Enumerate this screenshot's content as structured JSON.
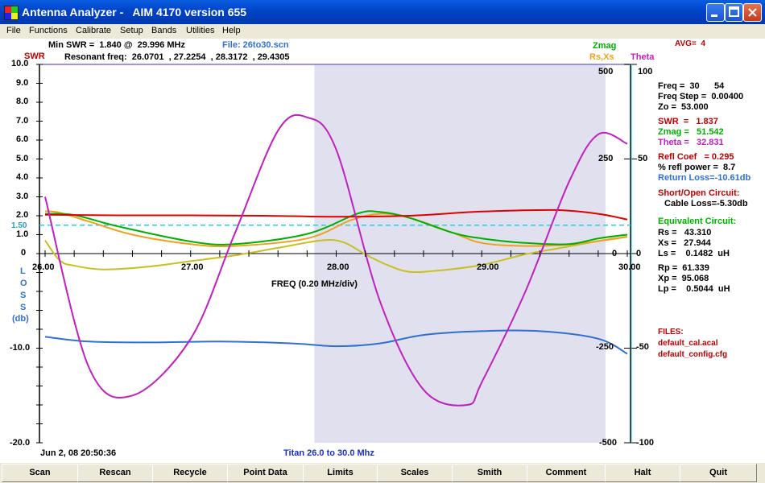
{
  "window": {
    "title": "Antenna Analyzer -   AIM 4170 version 655"
  },
  "menu": [
    "File",
    "Functions",
    "Calibrate",
    "Setup",
    "Bands",
    "Utilities",
    "Help"
  ],
  "header": {
    "min_swr": "Min SWR =  1.840 @  29.996 MHz",
    "file": "File: 26to30.scn",
    "resonant": "Resonant freq:  26.0701  , 27.2254  , 28.3172  , 29.4305",
    "avg": "AVG=  4",
    "swr_label": "SWR",
    "zmag_label": "Zmag",
    "rsxs_label": "Rs,Xs",
    "theta_label": "Theta"
  },
  "axes": {
    "swr_ticks": [
      "10.0",
      "9.0",
      "8.0",
      "7.0",
      "6.0",
      "5.0",
      "4.0",
      "3.0",
      "2.0",
      "1.0",
      "0"
    ],
    "swr_marker": "1.50",
    "loss_ticks": [
      "-10.0",
      "-20.0"
    ],
    "loss_label": [
      "L",
      "O",
      "S",
      "S",
      "(db)"
    ],
    "rs_ticks": [
      "500",
      "250",
      "0",
      "-250",
      "-500"
    ],
    "theta_ticks": [
      "100",
      "50",
      "0",
      "-50",
      "-100"
    ],
    "freq_ticks": [
      "26.00",
      "27.00",
      "28.00",
      "29.00",
      "30.00"
    ],
    "freq_label": "FREQ (0.20 MHz/div)"
  },
  "panel": {
    "freq": "Freq =  30      54",
    "freq_step": "Freq Step =  0.00400",
    "zo": "Zo =  53.000",
    "swr": "SWR  =   1.837",
    "zmag": "Zmag =   51.542",
    "theta": "Theta =   32.831",
    "refl_coef": "Refl Coef   = 0.295",
    "refl_power": "% refl power =  8.7",
    "return_loss": "Return Loss=-10.61db",
    "short_open": "Short/Open Circuit:",
    "cable_loss": "Cable Loss=-5.30db",
    "equiv": "Equivalent Circuit:",
    "rs": "Rs =   43.310",
    "xs": "Xs =   27.944",
    "ls": "Ls =    0.1482  uH",
    "rp": "Rp =  61.339",
    "xp": "Xp =  95.068",
    "lp": "Lp =    0.5044  uH",
    "files_label": "FILES:",
    "cal_file": "default_cal.acal",
    "config_file": "default_config.cfg"
  },
  "status": {
    "datetime": "Jun 2, 08   20:50:36",
    "band": "Titan 26.0 to 30.0 Mhz"
  },
  "buttons": [
    "Scan",
    "Rescan",
    "Recycle",
    "Point Data",
    "Limits",
    "Scales",
    "Smith",
    "Comment",
    "Halt",
    "Quit"
  ],
  "chart_data": {
    "type": "line",
    "x_range_mhz": [
      26.0,
      30.0
    ],
    "swr_range": [
      0,
      10
    ],
    "loss_range_db": [
      -20,
      0
    ],
    "rs_xs_range_ohm": [
      -500,
      500
    ],
    "theta_range_deg": [
      -100,
      100
    ],
    "selected_band_mhz": [
      27.85,
      29.85
    ],
    "swr_target": 1.5,
    "series": [
      {
        "name": "SWR",
        "color": "#e00000",
        "x": [
          26.0,
          26.5,
          27.0,
          27.5,
          28.0,
          28.5,
          29.0,
          29.5,
          29.8,
          30.0
        ],
        "y": [
          2.05,
          2.02,
          2.02,
          2.0,
          1.95,
          2.0,
          2.22,
          2.3,
          2.1,
          1.8
        ]
      },
      {
        "name": "Zmag",
        "color": "#00b000",
        "x": [
          26.0,
          26.2,
          26.5,
          27.0,
          27.3,
          27.8,
          28.15,
          28.3,
          28.5,
          28.8,
          29.0,
          29.3,
          29.6,
          29.8,
          30.0
        ],
        "y": [
          105,
          102,
          72,
          32,
          25,
          52,
          106,
          110,
          95,
          55,
          40,
          28,
          25,
          40,
          50
        ]
      },
      {
        "name": "Rs",
        "color": "#f0a020",
        "x": [
          26.0,
          26.1,
          26.3,
          26.6,
          27.0,
          27.3,
          27.8,
          28.1,
          28.3,
          28.5,
          28.8,
          29.0,
          29.3,
          29.6,
          29.8,
          30.0
        ],
        "y": [
          112,
          108,
          85,
          50,
          25,
          20,
          40,
          88,
          105,
          95,
          55,
          28,
          20,
          24,
          33,
          44
        ]
      },
      {
        "name": "Xs",
        "color": "#c8c020",
        "x": [
          26.0,
          26.1,
          26.2,
          26.4,
          26.7,
          27.0,
          27.3,
          27.6,
          27.9,
          28.05,
          28.2,
          28.35,
          28.5,
          28.7,
          29.0,
          29.3,
          29.5,
          29.8,
          30.0
        ],
        "y": [
          35,
          -18,
          -32,
          -42,
          -35,
          -20,
          -5,
          15,
          35,
          30,
          -2,
          -30,
          -48,
          -45,
          -30,
          -2,
          12,
          33,
          45
        ]
      },
      {
        "name": "Theta",
        "color": "#c020c0",
        "x": [
          26.0,
          26.3,
          26.6,
          27.0,
          27.3,
          27.6,
          27.8,
          28.0,
          28.3,
          28.6,
          28.9,
          29.0,
          29.3,
          29.6,
          29.8,
          30.0
        ],
        "y": [
          30,
          -60,
          -75,
          -45,
          10,
          65,
          72,
          55,
          -25,
          -72,
          -80,
          -68,
          -20,
          38,
          63,
          58
        ]
      },
      {
        "name": "Return Loss",
        "color": "#3070d0",
        "x": [
          26.0,
          26.3,
          26.7,
          27.2,
          27.7,
          28.0,
          28.3,
          28.6,
          29.0,
          29.4,
          29.8,
          30.0
        ],
        "y": [
          -8.8,
          -9.3,
          -9.4,
          -9.3,
          -9.5,
          -9.8,
          -9.5,
          -8.6,
          -8.2,
          -8.2,
          -9.0,
          -10.6
        ]
      }
    ]
  }
}
